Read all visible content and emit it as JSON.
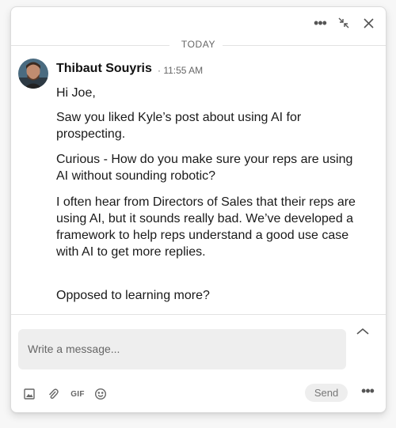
{
  "header": {
    "more_icon": "more-dots-icon",
    "minimize_icon": "minimize-arrows-icon",
    "close_icon": "close-icon"
  },
  "conversation": {
    "date_label": "TODAY",
    "message": {
      "sender": "Thibaut Souyris",
      "time": "· 11:55 AM",
      "paragraphs": [
        "Hi Joe,",
        "Saw you liked Kyle’s post about using AI for prospecting.",
        "Curious - How do you make sure your reps are using AI without sounding robotic?",
        "I often hear from Directors of Sales that their reps are using AI, but it sounds really bad. We’ve developed a framework to help reps understand a good use case with AI to get more replies.",
        "Opposed to learning more?"
      ]
    }
  },
  "composer": {
    "placeholder": "Write a message...",
    "value": "",
    "gif_label": "GIF",
    "send_label": "Send",
    "icons": [
      "image-icon",
      "paperclip-icon",
      "gif-icon",
      "emoji-icon",
      "chevron-up-icon",
      "more-dots-icon"
    ]
  }
}
